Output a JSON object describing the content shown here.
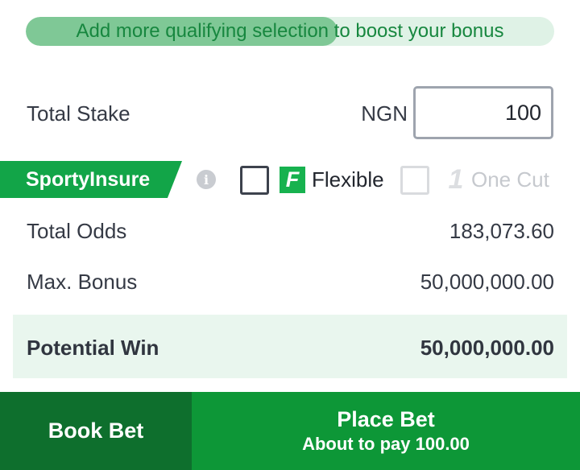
{
  "bonus": {
    "message": "Add more qualifying selection to boost your bonus",
    "progress_fraction": 0.59
  },
  "stake": {
    "label": "Total Stake",
    "currency": "NGN",
    "value": "100"
  },
  "insure": {
    "label": "SportyInsure",
    "info_icon": "info-icon",
    "flexible_badge": "F",
    "flexible_label": "Flexible",
    "flexible_checked": false,
    "onecut_badge": "1",
    "onecut_label": "One Cut",
    "onecut_enabled": false
  },
  "summary": {
    "total_odds_label": "Total Odds",
    "total_odds_value": "183,073.60",
    "max_bonus_label": "Max. Bonus",
    "max_bonus_value": "50,000,000.00",
    "potential_win_label": "Potential Win",
    "potential_win_value": "50,000,000.00"
  },
  "actions": {
    "book_label": "Book Bet",
    "place_label": "Place Bet",
    "place_sub": "About to pay 100.00"
  },
  "colors": {
    "brand_green": "#0d9737",
    "dark_green": "#0e6f2d",
    "tag_green": "#12a548",
    "progress_fill": "#7fc896",
    "progress_track": "#dff2e6",
    "win_band": "#e9f6ee"
  }
}
